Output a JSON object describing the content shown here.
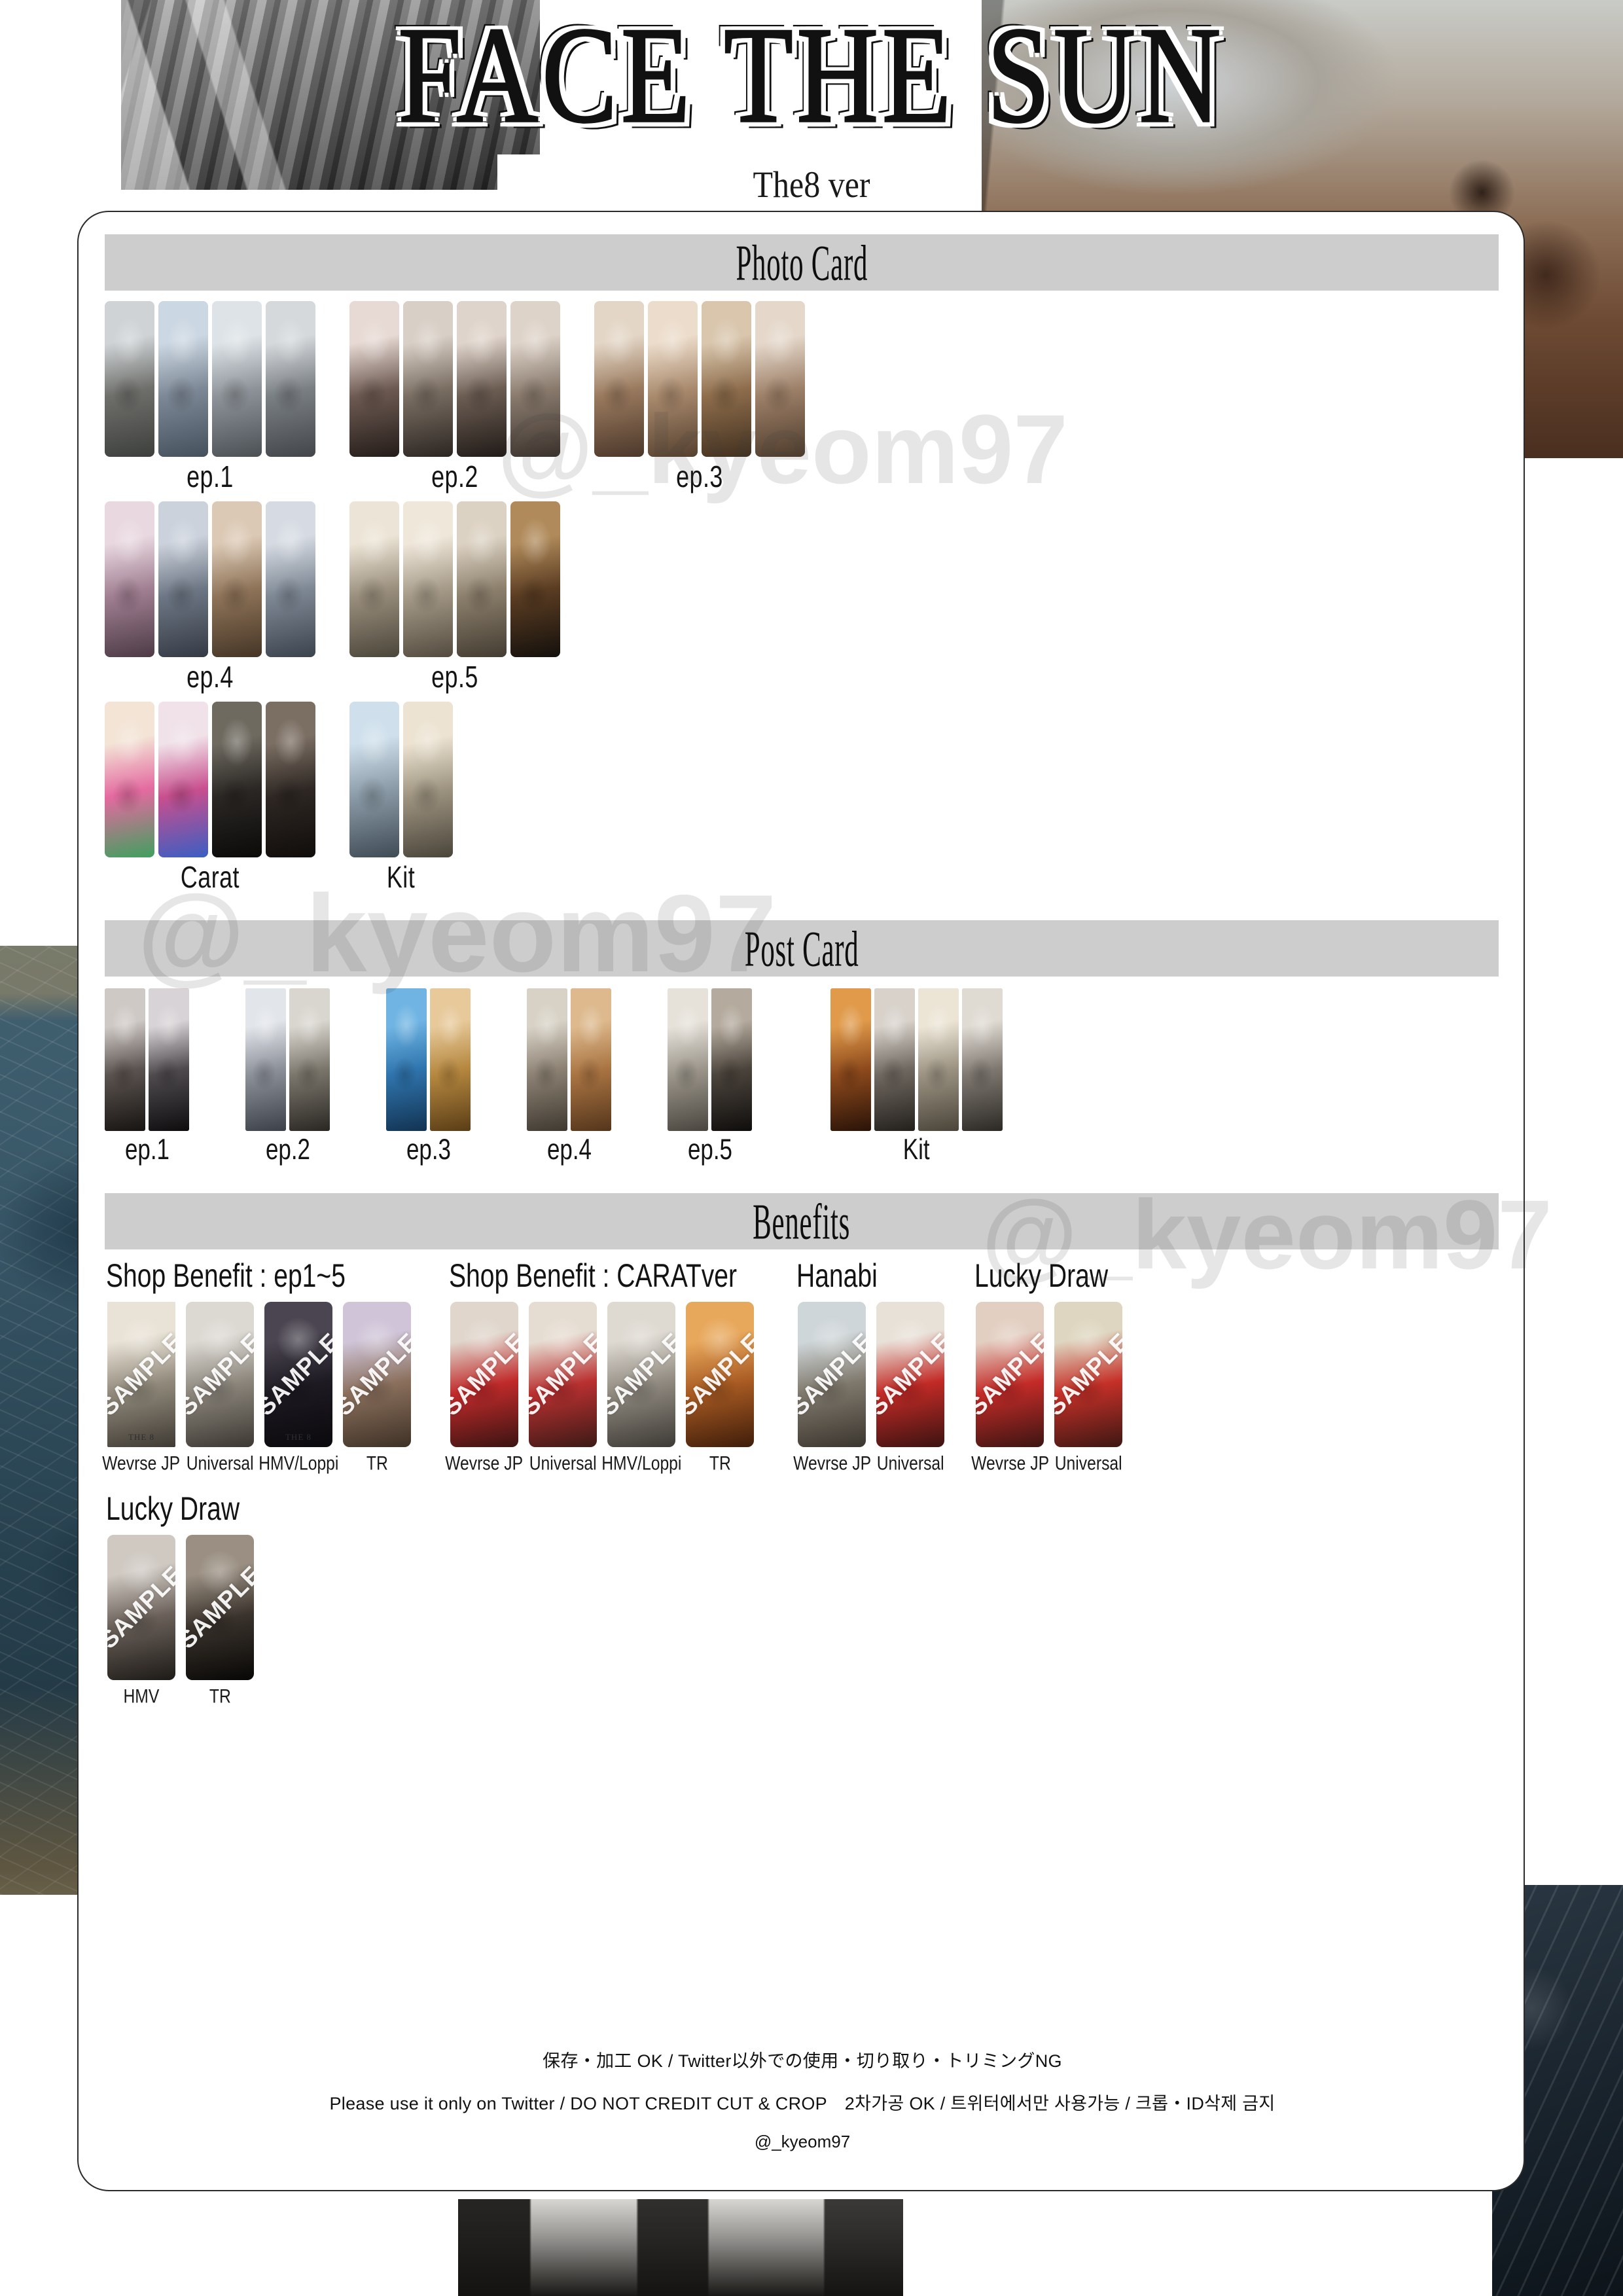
{
  "poster": {
    "title": "FACE THE SUN",
    "subtitle": "The8 ver",
    "credit_handle": "@_kyeom97"
  },
  "sections": [
    {
      "id": "photo-card",
      "heading": "Photo Card"
    },
    {
      "id": "post-card",
      "heading": "Post Card"
    },
    {
      "id": "benefits",
      "heading": "Benefits"
    }
  ],
  "photo_card": {
    "heading": "Photo Card",
    "rows": [
      {
        "groups": [
          {
            "label": "ep.1",
            "count": 4,
            "images": [
              {
                "alt": "the8-grey-coat-portrait",
                "a": "#cfd3d6",
                "b": "#6e6f6b",
                "c": "#3d3f3c"
              },
              {
                "alt": "the8-finger-heart-eyes",
                "a": "#cbd7e2",
                "b": "#7d8896",
                "c": "#44505c"
              },
              {
                "alt": "the8-hand-heart-smile",
                "a": "#dde3e7",
                "b": "#8e9399",
                "c": "#4b5055"
              },
              {
                "alt": "the8-v-pose-grey",
                "a": "#d5d9dc",
                "b": "#7a7f84",
                "c": "#42464a"
              }
            ]
          },
          {
            "label": "ep.2",
            "count": 4,
            "images": [
              {
                "alt": "the8-hand-on-cheek-sequin",
                "a": "#e7d9d3",
                "b": "#6d5a52",
                "c": "#241c19"
              },
              {
                "alt": "the8-sequin-jacket-closeup",
                "a": "#d8cfc6",
                "b": "#7a6e63",
                "c": "#2b2521"
              },
              {
                "alt": "the8-black-sequin-portrait",
                "a": "#dfd4cb",
                "b": "#6c5d53",
                "c": "#201a17"
              },
              {
                "alt": "the8-hair-up-smile",
                "a": "#ded3c9",
                "b": "#897a6d",
                "c": "#3a312b"
              }
            ]
          },
          {
            "label": "ep.3",
            "count": 4,
            "images": [
              {
                "alt": "the8-floral-jacket-hand-sign",
                "a": "#e3d6c6",
                "b": "#9a7a5e",
                "c": "#4b372a"
              },
              {
                "alt": "the8-floral-smile",
                "a": "#ecdccb",
                "b": "#a98a6d",
                "c": "#55402f"
              },
              {
                "alt": "the8-peace-sign-wood",
                "a": "#d9c6ad",
                "b": "#8e6d4c",
                "c": "#42301f"
              },
              {
                "alt": "the8-cheek-touch-sky",
                "a": "#e5d8cb",
                "b": "#9d8068",
                "c": "#4d3b2c"
              }
            ]
          }
        ]
      },
      {
        "groups": [
          {
            "label": "ep.4",
            "count": 4,
            "images": [
              {
                "alt": "the8-denim-hand-heart",
                "a": "#e9d8e0",
                "b": "#a07f92",
                "c": "#4c3a45"
              },
              {
                "alt": "the8-denim-pout",
                "a": "#cbd2dc",
                "b": "#6d7684",
                "c": "#343a44"
              },
              {
                "alt": "the8-denim-desert",
                "a": "#dcc9b5",
                "b": "#8e7358",
                "c": "#453526"
              },
              {
                "alt": "the8-denim-selfie-sky",
                "a": "#d6dbe3",
                "b": "#7e8894",
                "c": "#3b434d"
              }
            ]
          },
          {
            "label": "ep.5",
            "count": 4,
            "images": [
              {
                "alt": "the8-white-scarf-portrait",
                "a": "#ece4d6",
                "b": "#9a8f7d",
                "c": "#4b453a"
              },
              {
                "alt": "the8-white-scarf-eyes-closed",
                "a": "#efe7da",
                "b": "#a59a88",
                "c": "#534b3f"
              },
              {
                "alt": "the8-white-scarf-sunset",
                "a": "#dcd2c3",
                "b": "#8c7f6c",
                "c": "#433c32"
              },
              {
                "alt": "the8-dark-fire-pose",
                "a": "#b08a5a",
                "b": "#5a3c22",
                "c": "#14100c"
              }
            ]
          }
        ]
      },
      {
        "groups": [
          {
            "label": "Carat",
            "count": 4,
            "images": [
              {
                "alt": "the8-paint-pink-green",
                "a": "#f3e4d6",
                "b": "#e46aa0",
                "c": "#3fa05e"
              },
              {
                "alt": "the8-paint-star-face",
                "a": "#f0e2e8",
                "b": "#c84f8e",
                "c": "#3b5ec2"
              },
              {
                "alt": "the8-sunglasses-dark",
                "a": "#6e6a60",
                "b": "#2a2724",
                "c": "#0b0a09"
              },
              {
                "alt": "the8-sunglasses-leather",
                "a": "#7b6e63",
                "b": "#2e2723",
                "c": "#100d0b"
              }
            ]
          },
          {
            "label": "Kit",
            "count": 2,
            "images": [
              {
                "alt": "the8-floral-kit-blue-sky",
                "a": "#cfe0ec",
                "b": "#8a9aa6",
                "c": "#3f4b55"
              },
              {
                "alt": "the8-cream-scarf-kit",
                "a": "#ece3d2",
                "b": "#9d9380",
                "c": "#4a443a"
              }
            ]
          }
        ]
      }
    ]
  },
  "post_card": {
    "heading": "Post Card",
    "groups": [
      {
        "label": "ep.1",
        "count": 2,
        "images": [
          {
            "alt": "the8-black-suit-lean",
            "a": "#cfc9c6",
            "b": "#5b534f",
            "c": "#171412"
          },
          {
            "alt": "the8-black-suit-standing",
            "a": "#d8d3d6",
            "b": "#4e4a4d",
            "c": "#0e0d0e"
          }
        ]
      },
      {
        "label": "ep.2",
        "count": 2,
        "images": [
          {
            "alt": "the8-arm-up-light",
            "a": "#e2e5ea",
            "b": "#8c9099",
            "c": "#3c4048"
          },
          {
            "alt": "the8-ribbon-stripes",
            "a": "#d9d6cf",
            "b": "#7b766c",
            "c": "#2a2723"
          }
        ]
      },
      {
        "label": "ep.3",
        "count": 2,
        "images": [
          {
            "alt": "the8-blue-backdrop-portrait",
            "a": "#6fb4e3",
            "b": "#2f74ad",
            "c": "#123352"
          },
          {
            "alt": "the8-golden-branch",
            "a": "#e7c99a",
            "b": "#b5873f",
            "c": "#5a3d16"
          }
        ]
      },
      {
        "label": "ep.4",
        "count": 2,
        "images": [
          {
            "alt": "the8-desert-leaning",
            "a": "#d8d2c6",
            "b": "#8c8173",
            "c": "#3f3930"
          },
          {
            "alt": "the8-desert-wide",
            "a": "#ddb98d",
            "b": "#a97442",
            "c": "#54351b"
          }
        ]
      },
      {
        "label": "ep.5",
        "count": 2,
        "images": [
          {
            "alt": "the8-cream-outfit-sitting",
            "a": "#e6e2da",
            "b": "#9b958a",
            "c": "#4a463f"
          },
          {
            "alt": "the8-dark-helmet-scene",
            "a": "#b4aa9d",
            "b": "#4b443c",
            "c": "#0f0d0c"
          }
        ]
      },
      {
        "label": "Kit",
        "count": 4,
        "images": [
          {
            "alt": "the8-fire-branches",
            "a": "#e09a4a",
            "b": "#8e4a1c",
            "c": "#2a1308"
          },
          {
            "alt": "the8-black-branch-backdrop",
            "a": "#d8d2cb",
            "b": "#6f6860",
            "c": "#23201c"
          },
          {
            "alt": "the8-cream-scarf-closeup",
            "a": "#ece5d6",
            "b": "#9b9281",
            "c": "#4a443a"
          },
          {
            "alt": "the8-bike-cream-outfit",
            "a": "#dfdad2",
            "b": "#7e7870",
            "c": "#2c2925"
          }
        ]
      }
    ]
  },
  "benefits": {
    "heading": "Benefits",
    "sample_watermark": "SAMPLE",
    "the8_tag": "THE 8",
    "blocks": [
      {
        "title": "Shop Benefit : ep1~5",
        "items": [
          {
            "caption": "Wevrse JP",
            "alt": "the8-cream-scarf-benefit",
            "flat": true,
            "tag": "THE 8",
            "a": "#e9e2d6",
            "b": "#918a7c",
            "c": "#3f3a33"
          },
          {
            "caption": "Universal",
            "alt": "the8-grey-coat-benefit",
            "flat": false,
            "a": "#dcd9d3",
            "b": "#8b857b",
            "c": "#3c3832"
          },
          {
            "caption": "HMV/Loppi",
            "alt": "the8-night-profile-benefit",
            "flat": false,
            "tag": "THE 8",
            "a": "#4a4550",
            "b": "#1d1a22",
            "c": "#0a090c"
          },
          {
            "caption": "TR",
            "alt": "the8-floral-shirt-benefit",
            "flat": false,
            "a": "#cfc4d8",
            "b": "#8a6f5c",
            "c": "#3e3126"
          }
        ]
      },
      {
        "title": "Shop Benefit : CARATver",
        "items": [
          {
            "caption": "Wevrse JP",
            "alt": "the8-red-hair-benefit",
            "flat": false,
            "a": "#e0d6cc",
            "b": "#c02a2a",
            "c": "#3a1412"
          },
          {
            "caption": "Universal",
            "alt": "the8-red-hair-lying-benefit",
            "flat": false,
            "a": "#e6ddd2",
            "b": "#b93030",
            "c": "#3c1a16"
          },
          {
            "caption": "HMV/Loppi",
            "alt": "the8-white-scarf-grey-benefit",
            "flat": false,
            "a": "#ded9d1",
            "b": "#8f897f",
            "c": "#3d3a35"
          },
          {
            "caption": "TR",
            "alt": "the8-floral-orange-benefit",
            "flat": false,
            "a": "#e8a85c",
            "b": "#a85a22",
            "c": "#3f1d0a"
          }
        ]
      },
      {
        "title": "Hanabi",
        "items": [
          {
            "caption": "Wevrse JP",
            "alt": "the8-outdoor-coat-hanabi",
            "flat": false,
            "a": "#cfd6d9",
            "b": "#7f786c",
            "c": "#3a352e"
          },
          {
            "caption": "Universal",
            "alt": "the8-red-hair-hanabi",
            "flat": false,
            "a": "#e8e1d8",
            "b": "#c22a26",
            "c": "#3b1311"
          }
        ]
      },
      {
        "title": "Lucky Draw",
        "items": [
          {
            "caption": "Wevrse JP",
            "alt": "the8-red-hair-hand-luckydraw",
            "flat": false,
            "a": "#e3cfc2",
            "b": "#c42b28",
            "c": "#3c1512"
          },
          {
            "caption": "Universal",
            "alt": "the8-red-hair-lying-luckydraw",
            "flat": false,
            "a": "#ded6c0",
            "b": "#c53028",
            "c": "#3d1713"
          }
        ]
      }
    ],
    "bottom_block": {
      "title": "Lucky Draw",
      "items": [
        {
          "caption": "HMV",
          "alt": "the8-striped-jacket-luckydraw",
          "flat": false,
          "a": "#cfc9c2",
          "b": "#6a6059",
          "c": "#1d1a17"
        },
        {
          "caption": "TR",
          "alt": "the8-leather-coat-night-luckydraw",
          "flat": false,
          "a": "#9a8f82",
          "b": "#3a332c",
          "c": "#080706"
        }
      ]
    }
  },
  "footer": {
    "line1": "保存・加工 OK / Twitter以外での使用・切り取り・トリミングNG",
    "line2": "Please use it only on Twitter / DO NOT CREDIT CUT & CROP　2차가공 OK / 트위터에서만 사용가능 / 크롭・ID삭제 금지",
    "line3": "@_kyeom97"
  },
  "colors": {
    "section_bar": "#cdcdcd",
    "card_border": "#2b2b2b",
    "text": "#111111",
    "sample_watermark": "#ffffff"
  }
}
